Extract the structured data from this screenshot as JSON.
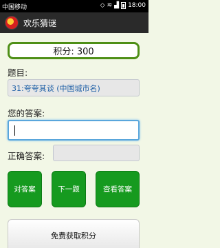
{
  "status": {
    "carrier": "中国移动",
    "time": "18:00"
  },
  "app": {
    "title": "欢乐猜谜"
  },
  "score": {
    "text": "积分: 300"
  },
  "question": {
    "label": "题目:",
    "text": "31:夸夸其谈 (中国城市名)"
  },
  "answer": {
    "label": "您的答案:",
    "value": ""
  },
  "correct": {
    "label": "正确答案:",
    "value": ""
  },
  "buttons": {
    "check": "对答案",
    "next": "下一题",
    "view": "查看答案",
    "free": "免费获取积分"
  },
  "colors": {
    "accent_green": "#169a1f",
    "score_border": "#4e8f16",
    "input_focus": "#59a6dc"
  }
}
